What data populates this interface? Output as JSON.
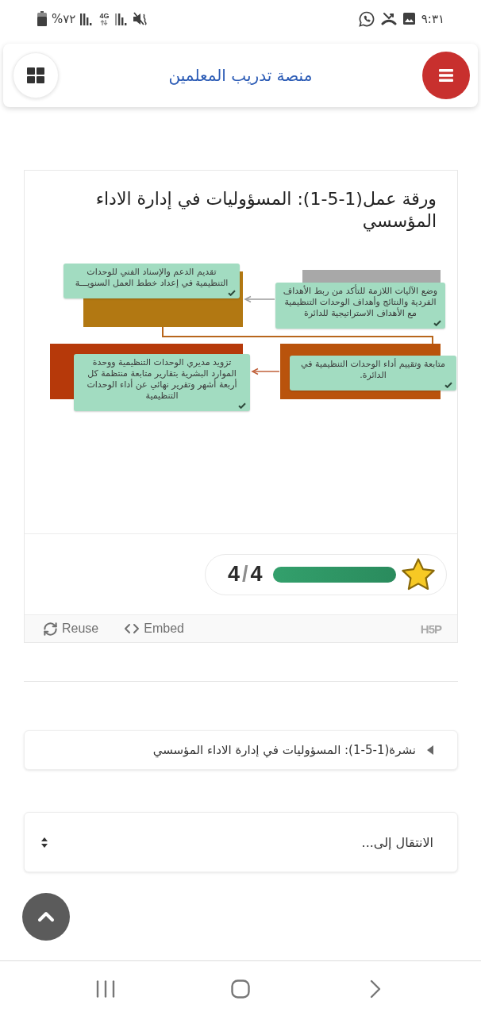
{
  "status_bar": {
    "time": "٩:٣١",
    "battery": "%٧٢",
    "network": "4G"
  },
  "header": {
    "title": "منصة تدريب المعلمين"
  },
  "activity": {
    "title": "ورقة عمل(1-5-1): المسؤوليات في إدارة الاداء المؤسسي",
    "drop_items": [
      {
        "text": "وضع الآليات اللازمة للتأكد من ربط الأهداف الفردية والنتائج وأهداف الوحدات التنظيمية مع الأهداف الاستراتيجية للدائرة",
        "correct": true
      },
      {
        "text": "تقديم الدعم والإسناد الفني للوحدات التنظيمية في إعداد خطط العمل السنويـــة",
        "correct": true
      },
      {
        "text": "متابعة وتقييم أداء الوحدات التنظيمية في الدائرة.",
        "correct": true
      },
      {
        "text": "تزويد مديري الوحدات التنظيمية ووحدة الموارد البشرية بتقارير متابعة منتظمة كل أربعة أشهر وتقرير نهائي عن أداء الوحدات التنظيمية",
        "correct": true
      }
    ],
    "score": {
      "value": "4",
      "separator": "/",
      "max": "4",
      "level": 1
    },
    "footer": {
      "actions": [
        {
          "kind": "embed",
          "label": "Embed"
        },
        {
          "kind": "reuse",
          "label": "Reuse"
        }
      ],
      "logo": "H5P"
    }
  },
  "previous_link": {
    "label": "نشرة(1-5-1): المسؤوليات في إدارة الاداء المؤسسي"
  },
  "jump_menu": {
    "value": "الانتقال إلى..."
  }
}
